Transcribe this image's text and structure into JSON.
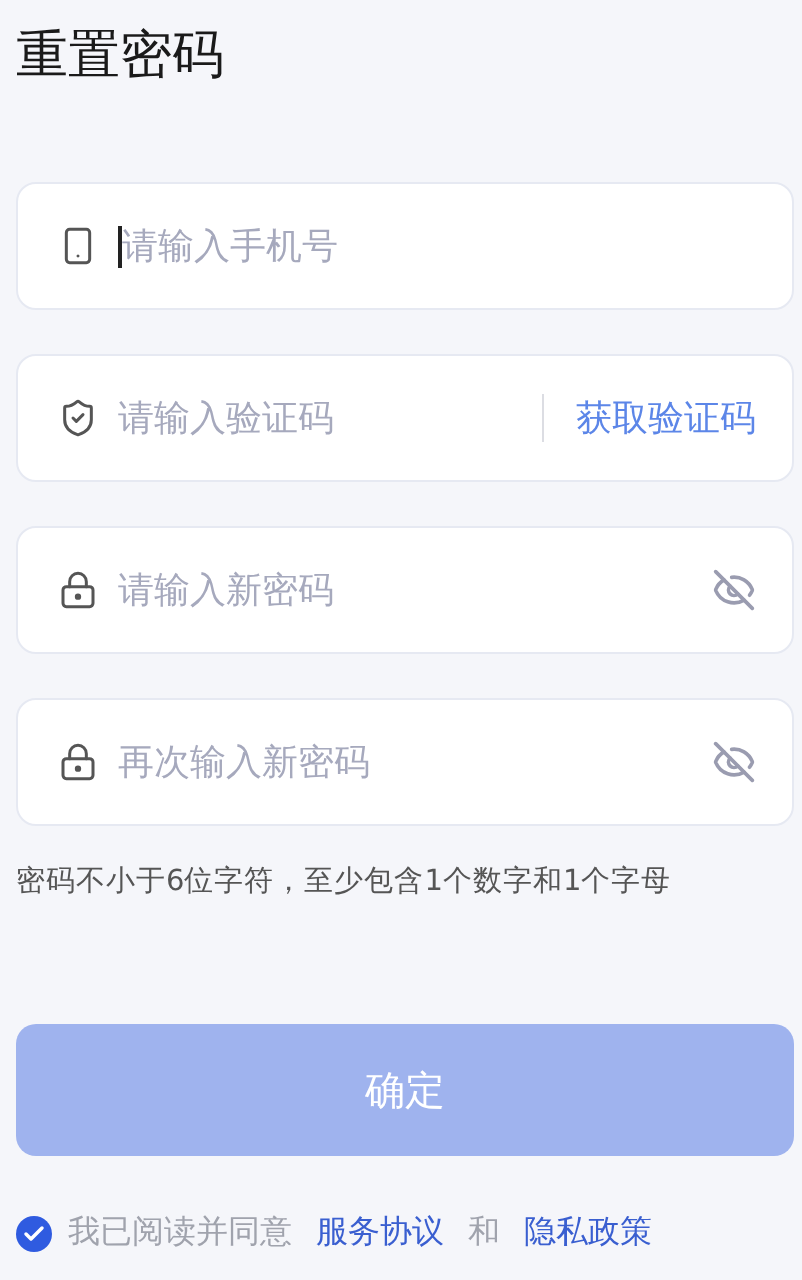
{
  "title": "重置密码",
  "fields": [
    {
      "kind": "phone",
      "placeholder": "请输入手机号",
      "focused": true
    },
    {
      "kind": "code",
      "placeholder": "请输入验证码",
      "action": "获取验证码"
    },
    {
      "kind": "password",
      "placeholder": "请输入新密码",
      "visible": false
    },
    {
      "kind": "password",
      "placeholder": "再次输入新密码",
      "visible": false
    }
  ],
  "hint": "密码不小于6位字符，至少包含1个数字和1个字母",
  "submit": {
    "label": "确定",
    "disabled": true
  },
  "agreement": {
    "checked": true,
    "text": "我已阅读并同意",
    "links": [
      "服务协议",
      "隐私政策"
    ],
    "joiner": "和"
  }
}
